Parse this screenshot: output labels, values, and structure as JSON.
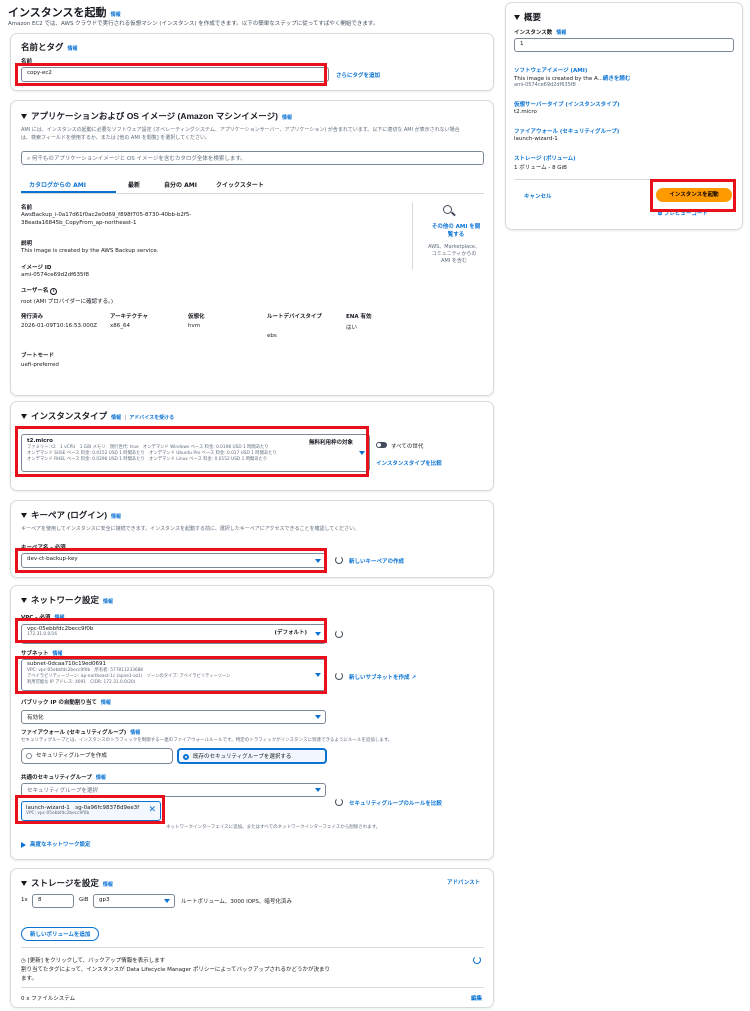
{
  "page": {
    "title": "インスタンスを起動",
    "info": "情報",
    "description": "Amazon EC2 では、AWS クラウドで実行される仮想マシン (インスタンス) を作成できます。以下の簡単なステップに従ってすばやく開始できます。"
  },
  "name_tags": {
    "title": "名前とタグ",
    "info": "情報",
    "name_label": "名前",
    "name_value": "copy-ec2",
    "add_tags": "さらにタグを追加"
  },
  "ami": {
    "title": "アプリケーションおよび OS イメージ (Amazon マシンイメージ)",
    "info": "情報",
    "description_line1": "AMI には、インスタンスの起動に必要なソフトウェア設定 (オペレーティングシステム、アプリケーションサーバー、アプリケーション) が含まれています。以下に適切な AMI が表示されない場合",
    "description_line2": "は、検索フィールドを使用するか、または [他の AMI を閲覧] を選択してください。",
    "search_placeholder": "何千ものアプリケーションイメージと OS イメージを含むカタログ全体を検索します。",
    "tabs": [
      "カタログからの AMI",
      "最新",
      "自分の AMI",
      "クイックスタート"
    ],
    "name_label": "名前",
    "name_line1": "AwsBackup_i-0a17d61f0ac2e0d69_f898f705-8730-40bb-b2f5-",
    "name_line2": "38eada16845b_CopyFrom_ap-northeast-1",
    "browse_line1": "その他の AMI を閲",
    "browse_line2": "覧する",
    "browse_note_line1": "AWS、Marketplace、",
    "browse_note_line2": "コミュニティからの",
    "browse_note_line3": "AMI を含む",
    "desc_label": "説明",
    "desc_value": "This image is created by the AWS Backup service.",
    "image_id_label": "イメージ ID",
    "image_id_value": "ami-0574ce69d2df635f8",
    "user_name_label": "ユーザー名",
    "user_name_value": "root (AMI プロバイダーに確認する。)",
    "columns": [
      {
        "label": "発行済み",
        "value": "2026-01-09T10:16:53.000Z"
      },
      {
        "label": "アーキテクチャ",
        "value": "x86_64"
      },
      {
        "label": "仮想化",
        "value": "hvm"
      },
      {
        "label": "ルートデバイスタイプ",
        "value": "ebs"
      },
      {
        "label": "ENA 有効",
        "value": "はい"
      }
    ],
    "boot_label": "ブートモード",
    "boot_value": "uefi-preferred"
  },
  "instance_type": {
    "title": "インスタンスタイプ",
    "info": "情報",
    "separator": "|",
    "advice": "アドバイスを受ける",
    "selected": "t2.micro",
    "free_tier": "無料利用枠の対象",
    "detail_line1": "ファミリー: t2　1 vCPU　1 GiB メモリ　現行世代: true　オンデマンド Windows ベース 料金: 0.0198 USD 1 時間あたり",
    "detail_line2": "オンデマンド SUSE ベース 料金: 0.0152 USD 1 時間あたり　オンデマンド Ubuntu Pro ベース 料金: 0.017 USD 1 時間あたり",
    "detail_line3": "オンデマンド RHEL ベース 料金: 0.0296 USD 1 時間あたり　オンデマンド Linux ベース 料金: 0.0152 USD 1 時間あたり",
    "all_generations": "すべての世代",
    "compare": "インスタンスタイプを比較"
  },
  "key_pair": {
    "title": "キーペア (ログイン)",
    "info": "情報",
    "description": "キーペアを使用してインスタンスに安全に接続できます。インスタンスを起動する前に、選択したキーペアにアクセスできることを確認してください。",
    "label": "キーペア名 - 必須",
    "value": "dev-ct-backup-key",
    "create": "新しいキーペアの作成"
  },
  "network": {
    "title": "ネットワーク設定",
    "info": "情報",
    "vpc_label": "VPC - 必須",
    "vpc_value": "vpc-05ebbfdc2becc9f0b",
    "vpc_cidr": "172.31.0.0/16",
    "vpc_default": "(デフォルト)",
    "subnet_label": "サブネット",
    "subnet_value": "subnet-0dcaa710c19ed0691",
    "subnet_line1": "VPC: vpc-05ebbfdc2becc9f0b　所有者: 577811233688",
    "subnet_line2": "アベイラビリティーゾーン: ap-northeast-1c (apne1-az1)　ゾーンのタイプ: アベイラビリティーゾーン",
    "subnet_line3": "利用可能な IP アドレス: 4091　CIDR: 172.31.0.0/20)",
    "create_subnet": "新しいサブネットを作成",
    "public_ip_label": "パブリック IP の自動割り当て",
    "public_ip_value": "有効化",
    "firewall_label": "ファイアウォール (セキュリティグループ)",
    "firewall_desc": "セキュリティグループとは、インスタンスのトラフィックを制御する一連のファイアウォールルールです。特定のトラフィックがインスタンスに到達できるようにルールを追加します。",
    "sg_create": "セキュリティグループを作成",
    "sg_existing": "既存のセキュリティグループを選択する",
    "common_sg_label": "共通のセキュリティグループ",
    "sg_select_placeholder": "セキュリティグループを選択",
    "sg_rules_compare": "セキュリティグループのルールを比較",
    "sg_token_name": "launch-wizard-1　sg-0a96fc98378d9ee3f",
    "sg_token_vpc": "VPC: vpc-05ebbfdc2becc9f0b",
    "sg_note": "ネットワークインターフェイスに追加。またはすべてのネットワークインターフェイスから削除されます。",
    "advanced": "高度なネットワーク設定"
  },
  "storage": {
    "title": "ストレージを設定",
    "info": "情報",
    "advanced": "アドバンスト",
    "count": "1x",
    "size": "8",
    "unit": "GiB",
    "type": "gp3",
    "desc": "ルートボリューム、3000 IOPS、暗号化済み",
    "add_volume": "新しいボリュームを追加",
    "backup_line1": "[更新] をクリックして、バックアップ情報を表示します",
    "backup_line2": "割り当てたタグによって、インスタンスが Data Lifecycle Manager ポリシーによってバックアップされるかどうかが決まり",
    "backup_line3": "ます。",
    "filesystems": "0 x ファイルシステム",
    "edit": "編集"
  },
  "summary": {
    "title": "概要",
    "count_label": "インスタンス数",
    "info": "情報",
    "count_value": "1",
    "ami_label": "ソフトウェアイメージ (AMI)",
    "ami_desc": "This image is created by the A...",
    "ami_more": "続きを読む",
    "ami_id": "ami-0574ce69d2df635f8",
    "vtype_label": "仮想サーバータイプ (インスタンスタイプ)",
    "vtype_value": "t2.micro",
    "fw_label": "ファイアウォール (セキュリティグループ)",
    "fw_value": "launch-wizard-1",
    "storage_label": "ストレージ (ボリューム)",
    "storage_value": "1 ボリューム - 8 GiB",
    "cancel": "キャンセル",
    "launch": "インスタンスを起動",
    "preview": "プレビューコード"
  },
  "colors": {
    "link": "#0972d3",
    "primary": "#ff9900",
    "highlight": "#e8101a"
  }
}
